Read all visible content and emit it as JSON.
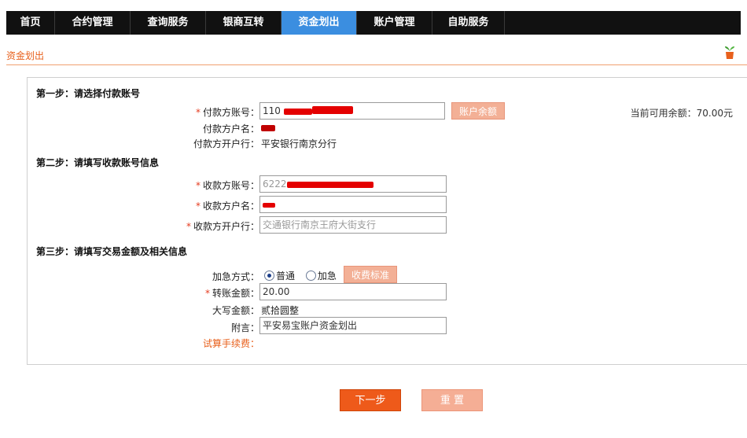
{
  "nav": {
    "tabs": [
      "首页",
      "合约管理",
      "查询服务",
      "银商互转",
      "资金划出",
      "账户管理",
      "自助服务"
    ],
    "active_index": 4
  },
  "breadcrumb": "资金划出",
  "step1": {
    "title": "第一步：请选择付款账号",
    "payer_account_label": "付款方账号：",
    "payer_account_value": "110",
    "balance_button": "账户余额",
    "available_balance": "当前可用余额：70.00元",
    "payer_name_label": "付款方户名：",
    "payer_bank_label": "付款方开户行：",
    "payer_bank_value": "平安银行南京分行"
  },
  "step2": {
    "title": "第二步：请填写收款账号信息",
    "payee_account_label": "收款方账号：",
    "payee_account_value": "6222",
    "payee_name_label": "收款方户名：",
    "payee_bank_label": "收款方开户行：",
    "payee_bank_value": "交通银行南京王府大街支行"
  },
  "step3": {
    "title": "第三步：请填写交易金额及相关信息",
    "urgency_label": "加急方式：",
    "urgency_options": [
      "普通",
      "加急"
    ],
    "fee_button": "收费标准",
    "amount_label": "转账金额：",
    "amount_value": "20.00",
    "amount_words_label": "大写金额：",
    "amount_words_value": "贰拾圆整",
    "memo_label": "附言：",
    "memo_value": "平安易宝账户资金划出",
    "fee_calc_label": "试算手续费："
  },
  "actions": {
    "next": "下一步",
    "reset": "重 置"
  },
  "colors": {
    "nav_bg": "#111111",
    "nav_active": "#3b8ee0",
    "accent": "#ee5a1a",
    "required": "#e53b1f"
  }
}
